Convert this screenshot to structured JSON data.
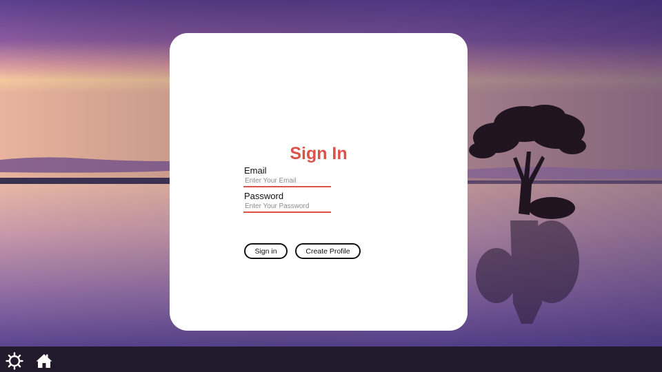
{
  "login": {
    "title": "Sign In",
    "email": {
      "label": "Email",
      "placeholder": "Enter Your Email",
      "value": ""
    },
    "password": {
      "label": "Password",
      "placeholder": "Enter Your Password",
      "value": ""
    },
    "buttons": {
      "sign_in": "Sign in",
      "create_profile": "Create Profile"
    }
  },
  "taskbar": {
    "icons": [
      "gear-icon",
      "home-icon"
    ]
  },
  "colors": {
    "accent": "#d9534a",
    "card": "#ffffff",
    "taskbar": "#211a2d"
  }
}
